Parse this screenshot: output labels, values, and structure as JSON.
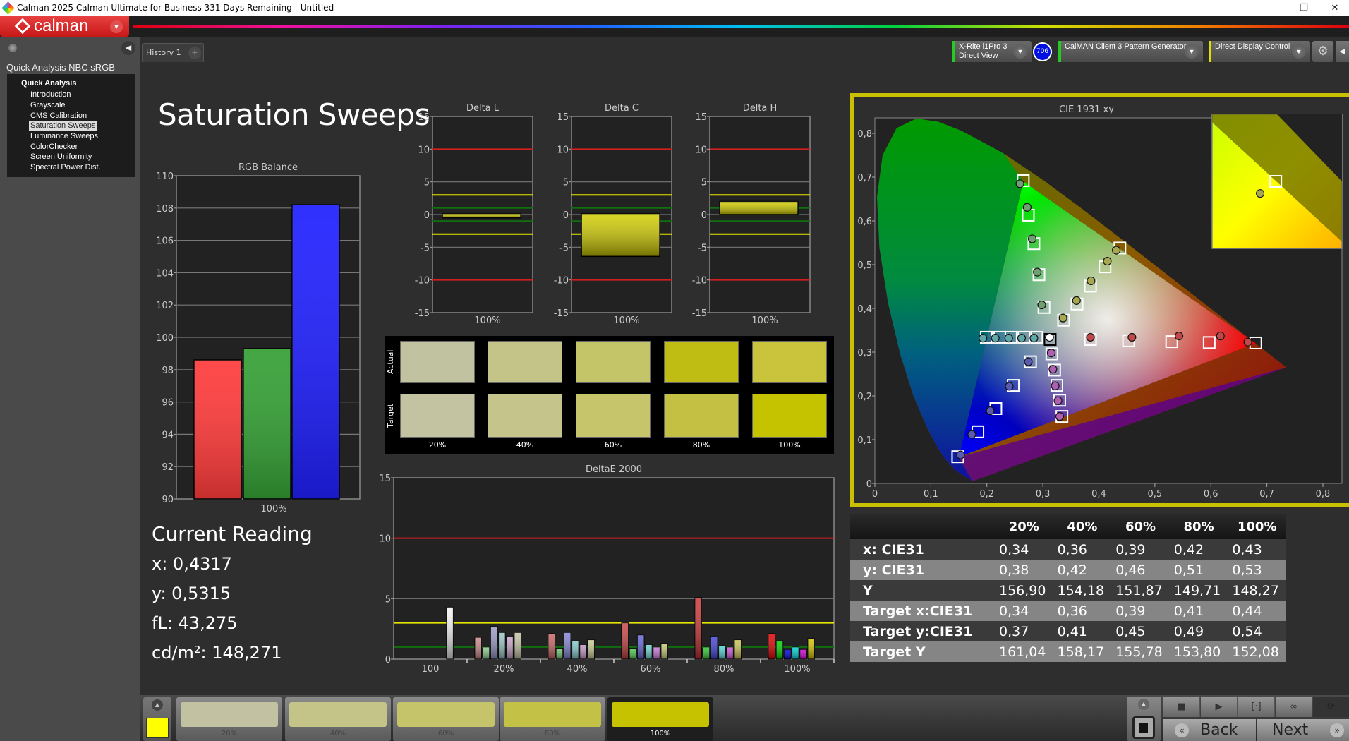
{
  "window": {
    "title": "Calman 2025 Calman Ultimate for Business 331 Days Remaining  - Untitled",
    "minimize": "—",
    "restore": "❐",
    "close": "✕"
  },
  "app": {
    "logo": "calman"
  },
  "sidebar": {
    "workflow_title": "Quick Analysis NBC sRGB",
    "root": "Quick Analysis",
    "items": [
      "Introduction",
      "Grayscale",
      "CMS Calibration",
      "Saturation Sweeps",
      "Luminance Sweeps",
      "ColorChecker",
      "Screen Uniformity",
      "Spectral Power Dist."
    ],
    "selected": "Saturation Sweeps"
  },
  "tabs": [
    {
      "label": "History 1"
    }
  ],
  "tab_add": "+",
  "devices": {
    "meter": {
      "line1": "X-Rite i1Pro 3",
      "line2": "Direct View",
      "badge": "706",
      "status_color": "#22cc22"
    },
    "source": {
      "label": "CalMAN Client 3 Pattern Generator",
      "status_color": "#22cc22"
    },
    "display": {
      "label": "Direct Display Control",
      "status_color": "#e0e000"
    }
  },
  "page_title": "Saturation Sweeps",
  "current_reading": {
    "title": "Current Reading",
    "x": "x: 0,4317",
    "y": "y: 0,5315",
    "fl": "fL: 43,275",
    "cdm2": "cd/m²: 148,271"
  },
  "chart_data": [
    {
      "id": "rgb",
      "type": "bar",
      "title": "RGB Balance",
      "categories": [
        "100%"
      ],
      "ylim": [
        90,
        110
      ],
      "yticks": [
        90,
        92,
        94,
        96,
        98,
        100,
        102,
        104,
        106,
        108,
        110
      ],
      "series": [
        {
          "name": "R",
          "values": [
            98.6
          ],
          "color": "#ff3b3b"
        },
        {
          "name": "G",
          "values": [
            99.3
          ],
          "color": "#35a035"
        },
        {
          "name": "B",
          "values": [
            108.2
          ],
          "color": "#2020ff"
        }
      ],
      "grid": true
    },
    {
      "id": "dl",
      "type": "bar",
      "title": "Delta L",
      "categories": [
        "100%"
      ],
      "values": [
        -0.5
      ],
      "ylim": [
        -15,
        15
      ],
      "yticks": [
        15,
        10,
        5,
        0,
        -5,
        -10,
        -15
      ],
      "limits": {
        "red": 10,
        "yellow": 3,
        "green": 1
      },
      "color": "#d0cc00"
    },
    {
      "id": "dc",
      "type": "bar",
      "title": "Delta C",
      "categories": [
        "100%"
      ],
      "values": [
        -6.4
      ],
      "ylim": [
        -15,
        15
      ],
      "yticks": [
        15,
        10,
        5,
        0,
        -5,
        -10,
        -15
      ],
      "limits": {
        "red": 10,
        "yellow": 3,
        "green": 1
      },
      "color": "#d0cc00"
    },
    {
      "id": "dh",
      "type": "bar",
      "title": "Delta H",
      "categories": [
        "100%"
      ],
      "values": [
        2.0
      ],
      "ylim": [
        -15,
        15
      ],
      "yticks": [
        15,
        10,
        5,
        0,
        -5,
        -10,
        -15
      ],
      "limits": {
        "red": 10,
        "yellow": 3,
        "green": 1
      },
      "color": "#d0cc00"
    },
    {
      "id": "de",
      "type": "bar",
      "title": "DeltaE 2000",
      "ylim": [
        0,
        15
      ],
      "yticks": [
        15,
        10,
        5,
        0
      ],
      "limits": {
        "red": 10,
        "yellow": 3,
        "green": 1
      },
      "groups": [
        {
          "label": "100",
          "values": [
            4.3
          ],
          "colors": [
            "#f4f4f4"
          ]
        },
        {
          "label": "20%",
          "values": [
            1.8,
            1.0,
            2.7,
            2.2,
            1.9,
            2.2
          ],
          "colors": [
            "#c88888",
            "#88c888",
            "#9a9ac8",
            "#98c4c4",
            "#c8a4c8",
            "#c4c4a4"
          ]
        },
        {
          "label": "40%",
          "values": [
            2.1,
            0.9,
            2.2,
            1.5,
            1.2,
            1.6
          ],
          "colors": [
            "#c86464",
            "#70c070",
            "#8484d4",
            "#84c8c8",
            "#c494c4",
            "#c8c894"
          ]
        },
        {
          "label": "60%",
          "values": [
            3.0,
            0.9,
            2.0,
            1.2,
            1.0,
            1.3
          ],
          "colors": [
            "#c84444",
            "#50c450",
            "#6464d4",
            "#70d0d0",
            "#c474d4",
            "#c8c874"
          ]
        },
        {
          "label": "80%",
          "values": [
            5.1,
            1.0,
            1.9,
            1.1,
            1.0,
            1.6
          ],
          "colors": [
            "#cc3434",
            "#30c430",
            "#4444d8",
            "#54d0d0",
            "#c854d4",
            "#c8c454"
          ]
        },
        {
          "label": "100%",
          "values": [
            2.1,
            1.5,
            0.8,
            1.0,
            0.8,
            1.7
          ],
          "colors": [
            "#e00000",
            "#00d000",
            "#0000e0",
            "#00d0d0",
            "#d000d0",
            "#d0c000"
          ]
        }
      ]
    },
    {
      "id": "cie",
      "type": "scatter",
      "title": "CIE 1931 xy",
      "xlim": [
        0,
        0.8
      ],
      "ylim": [
        0,
        0.8
      ],
      "xticks": [
        "0",
        "0,1",
        "0,2",
        "0,3",
        "0,4",
        "0,5",
        "0,6",
        "0,7",
        "0,8"
      ],
      "yticks": [
        "0",
        "0,1",
        "0,2",
        "0,3",
        "0,4",
        "0,5",
        "0,6",
        "0,7",
        "0,8"
      ],
      "white": {
        "target": [
          0.313,
          0.329
        ],
        "measured": [
          0.312,
          0.334
        ]
      },
      "sweeps": [
        {
          "color": "red",
          "fill": "#c04848",
          "target": [
            [
              0.385,
              0.329
            ],
            [
              0.453,
              0.326
            ],
            [
              0.53,
              0.324
            ],
            [
              0.597,
              0.322
            ],
            [
              0.68,
              0.321
            ]
          ],
          "measured": [
            [
              0.385,
              0.334
            ],
            [
              0.459,
              0.334
            ],
            [
              0.543,
              0.337
            ],
            [
              0.617,
              0.337
            ],
            [
              0.666,
              0.323
            ]
          ]
        },
        {
          "color": "green",
          "fill": "#70a070",
          "target": [
            [
              0.302,
              0.402
            ],
            [
              0.293,
              0.477
            ],
            [
              0.284,
              0.548
            ],
            [
              0.274,
              0.613
            ],
            [
              0.265,
              0.692
            ]
          ],
          "measured": [
            [
              0.298,
              0.408
            ],
            [
              0.29,
              0.483
            ],
            [
              0.281,
              0.559
            ],
            [
              0.272,
              0.631
            ],
            [
              0.259,
              0.685
            ]
          ]
        },
        {
          "color": "blue",
          "fill": "#5a5ab0",
          "target": [
            [
              0.278,
              0.278
            ],
            [
              0.247,
              0.224
            ],
            [
              0.216,
              0.171
            ],
            [
              0.184,
              0.118
            ],
            [
              0.148,
              0.061
            ]
          ],
          "measured": [
            [
              0.274,
              0.278
            ],
            [
              0.24,
              0.222
            ],
            [
              0.206,
              0.166
            ],
            [
              0.173,
              0.112
            ],
            [
              0.153,
              0.065
            ]
          ]
        },
        {
          "color": "cyan",
          "fill": "#60a8a8",
          "target": [
            [
              0.289,
              0.334
            ],
            [
              0.266,
              0.334
            ],
            [
              0.243,
              0.334
            ],
            [
              0.223,
              0.334
            ],
            [
              0.199,
              0.334
            ]
          ],
          "measured": [
            [
              0.284,
              0.332
            ],
            [
              0.262,
              0.332
            ],
            [
              0.239,
              0.332
            ],
            [
              0.215,
              0.332
            ],
            [
              0.193,
              0.332
            ]
          ]
        },
        {
          "color": "magenta",
          "fill": "#b060b0",
          "target": [
            [
              0.316,
              0.296
            ],
            [
              0.321,
              0.259
            ],
            [
              0.325,
              0.224
            ],
            [
              0.33,
              0.19
            ],
            [
              0.334,
              0.153
            ]
          ],
          "measured": [
            [
              0.315,
              0.298
            ],
            [
              0.318,
              0.261
            ],
            [
              0.322,
              0.223
            ],
            [
              0.327,
              0.189
            ],
            [
              0.33,
              0.153
            ]
          ]
        },
        {
          "color": "yellow",
          "fill": "#a8a850",
          "target": [
            [
              0.337,
              0.373
            ],
            [
              0.361,
              0.41
            ],
            [
              0.385,
              0.451
            ],
            [
              0.411,
              0.495
            ],
            [
              0.4375,
              0.538
            ]
          ],
          "measured": [
            [
              0.336,
              0.378
            ],
            [
              0.36,
              0.418
            ],
            [
              0.386,
              0.463
            ],
            [
              0.415,
              0.508
            ],
            [
              0.431,
              0.533
            ]
          ]
        }
      ]
    }
  ],
  "swatch_panel": {
    "row_labels": [
      "Actual",
      "Target"
    ],
    "columns": [
      "20%",
      "40%",
      "60%",
      "80%",
      "100%"
    ],
    "actual": [
      "#c0c2a0",
      "#c4c489",
      "#c4c468",
      "#bfbd14",
      "#c9c43c"
    ],
    "target": [
      "#c3c3a2",
      "#c5c48a",
      "#c6c56b",
      "#c3c044",
      "#c5c300"
    ]
  },
  "table": {
    "columns": [
      "",
      "20%",
      "40%",
      "60%",
      "80%",
      "100%"
    ],
    "rows": [
      [
        "x: CIE31",
        "0,34",
        "0,36",
        "0,39",
        "0,42",
        "0,43"
      ],
      [
        "y: CIE31",
        "0,38",
        "0,42",
        "0,46",
        "0,51",
        "0,53"
      ],
      [
        "Y",
        "156,90",
        "154,18",
        "151,87",
        "149,71",
        "148,27"
      ],
      [
        "Target x:CIE31",
        "0,34",
        "0,36",
        "0,39",
        "0,41",
        "0,44"
      ],
      [
        "Target y:CIE31",
        "0,37",
        "0,41",
        "0,45",
        "0,49",
        "0,54"
      ],
      [
        "Target Y",
        "161,04",
        "158,17",
        "155,78",
        "153,80",
        "152,08"
      ]
    ]
  },
  "bottom_swatches": {
    "current_color": "#ffff00",
    "items": [
      {
        "label": "20%",
        "color": "#c2c2a2"
      },
      {
        "label": "40%",
        "color": "#c4c489"
      },
      {
        "label": "60%",
        "color": "#c5c46a"
      },
      {
        "label": "80%",
        "color": "#c4c246"
      },
      {
        "label": "100%",
        "color": "#c7c200",
        "selected": true
      }
    ]
  },
  "controls": {
    "stop": "■",
    "play": "▶",
    "measure": "[·]",
    "loop": "∞",
    "refresh": "⟳",
    "back": "Back",
    "next": "Next",
    "back_icon": "«",
    "next_icon": "»",
    "up": "▲",
    "dropdown": "▼",
    "collapse": "◀",
    "gear": "⚙"
  }
}
